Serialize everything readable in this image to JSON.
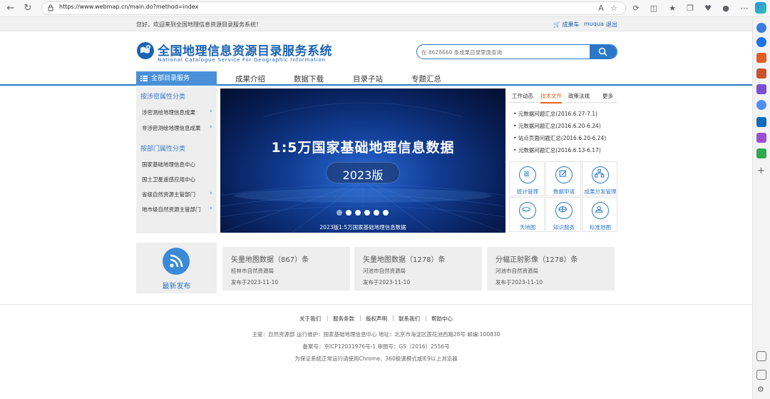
{
  "browser": {
    "url": "https://www.webmap.cn/main.do?method=index"
  },
  "topbar": {
    "welcome": "您好，欢迎来到全国地理信息资源目录服务系统！",
    "cart": "成果车",
    "user": "muqua",
    "logout": "退出"
  },
  "header": {
    "title": "全国地理信息资源目录服务系统",
    "subtitle": "National Catalogue Service For Geographic Information",
    "search_placeholder": "在 8628660 条成果目录里面查询"
  },
  "nav": {
    "all": "全部目录服务",
    "links": [
      "成果介绍",
      "数据下载",
      "目录子站",
      "专题汇总"
    ]
  },
  "categories": {
    "group1_title": "按涉密属性分类",
    "group1_items": [
      "涉密测绘地理信息成果",
      "非涉密测绘地理信息成果"
    ],
    "group2_title": "按部门属性分类",
    "group2_items": [
      "国家基础地理信息中心",
      "国土卫星遥感应用中心",
      "省级自然资源主管部门",
      "地市级自然资源主管部门"
    ]
  },
  "banner": {
    "title": "1:5万国家基础地理信息数据",
    "version": "2023版",
    "caption": "2023版1:5万国家基础地理信息数据",
    "slide_count": 6
  },
  "news": {
    "tabs": [
      "工作动态",
      "技术文件",
      "政策法规",
      "更多"
    ],
    "active_tab": "技术文件",
    "items": [
      "元数据问题汇总(2016.6.27-7.1)",
      "元数据问题汇总(2016.6.20-6.24)",
      "站点页面问题汇总(2016.6.20-6.24)",
      "元数据问题汇总(2016.6.13-6.17)"
    ]
  },
  "services": [
    {
      "label": "统计管理",
      "icon": "list-icon"
    },
    {
      "label": "数据申请",
      "icon": "edit-icon"
    },
    {
      "label": "成果分发管理",
      "icon": "network-icon"
    },
    {
      "label": "天地图",
      "icon": "tianditu-icon"
    },
    {
      "label": "知识服务",
      "icon": "knowledge-icon"
    },
    {
      "label": "标准地图",
      "icon": "map-pin-icon"
    }
  ],
  "latest": {
    "label": "最新发布",
    "cards": [
      {
        "title": "矢量地图数据（867）条",
        "org": "桂林市自然资源局",
        "date": "发布于2023-11-10"
      },
      {
        "title": "矢量地图数据（1278）条",
        "org": "河池市自然资源局",
        "date": "发布于2023-11-10"
      },
      {
        "title": "分幅正射影像（1278）条",
        "org": "河池市自然资源局",
        "date": "发布于2023-11-10"
      }
    ]
  },
  "footer": {
    "links": [
      "关于我们",
      "服务条款",
      "版权声明",
      "联系我们",
      "帮助中心"
    ],
    "line1": "主管：自然资源部 运行维护：国家基础地理信息中心 地址：北京市海淀区莲花池西路28号 邮编:100830",
    "line2": "备案号：京ICP12031976号-1 审图号：GS（2016）2556号",
    "line3": "为保证系统正常运行请使用Chrome、360极速模式或IE9以上浏览器"
  },
  "colors": {
    "brand_blue": "#2b78c8",
    "active_tab": "#e4651c"
  }
}
